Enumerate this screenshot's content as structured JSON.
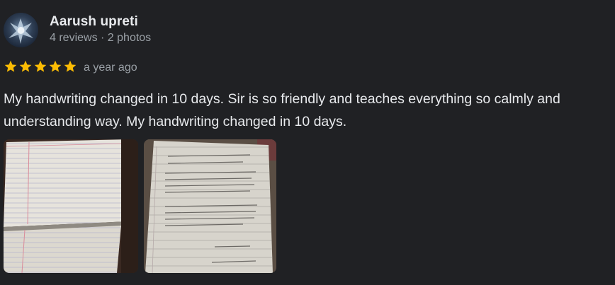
{
  "reviewer": {
    "name": "Aarush upreti",
    "stats": "4 reviews · 2 photos",
    "avatar_icon": "avatar-image"
  },
  "rating": {
    "stars": 5,
    "max": 5,
    "color": "#fbbc04"
  },
  "time_ago": "a year ago",
  "review_text": "My handwriting changed in 10 days. Sir is so friendly and teaches everything so calmly and understanding way. My handwriting changed in 10 days.",
  "photos": [
    "notebook-pages-photo",
    "handwritten-page-photo"
  ]
}
